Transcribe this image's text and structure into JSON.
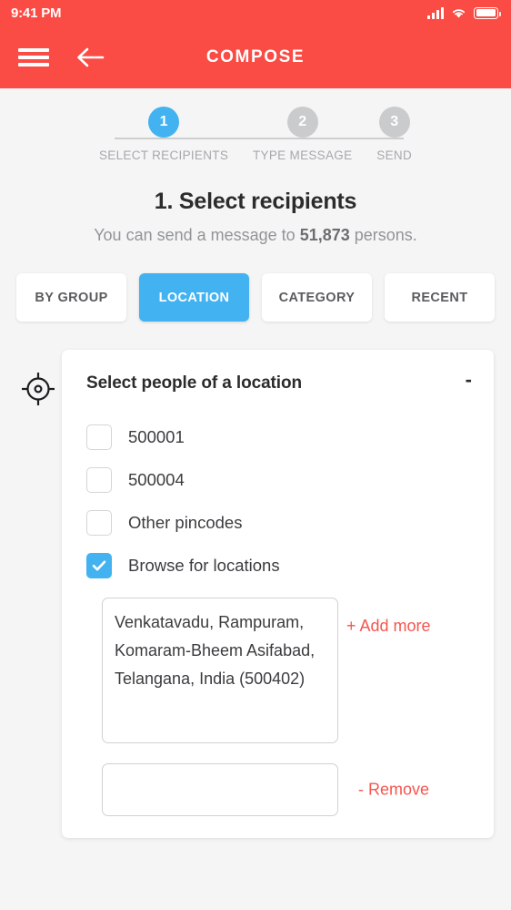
{
  "statusbar": {
    "time": "9:41 PM",
    "signal_icon": "signal-bars-icon",
    "wifi_icon": "wifi-icon",
    "battery_icon": "battery-icon"
  },
  "appbar": {
    "title": "COMPOSE",
    "menu_icon": "hamburger-menu-icon",
    "back_icon": "back-arrow-icon",
    "background_color": "#fa4b44"
  },
  "stepper": {
    "steps": [
      {
        "number": "1",
        "label": "SELECT RECIPIENTS",
        "active": true
      },
      {
        "number": "2",
        "label": "TYPE MESSAGE",
        "active": false
      },
      {
        "number": "3",
        "label": "SEND",
        "active": false
      }
    ],
    "active_color": "#42b2f0",
    "inactive_color": "#c9cbcd"
  },
  "heading": {
    "title": "1. Select recipients",
    "subtitle_prefix": "You can send a message to ",
    "subtitle_count": "51,873",
    "subtitle_suffix": " persons."
  },
  "tabs": [
    {
      "label": "BY GROUP",
      "active": false
    },
    {
      "label": "LOCATION",
      "active": true
    },
    {
      "label": "CATEGORY",
      "active": false
    },
    {
      "label": "RECENT",
      "active": false
    }
  ],
  "card": {
    "locate_icon": "crosshair-target-icon",
    "title": "Select people of a location",
    "collapse_label": "-",
    "options": [
      {
        "label": "500001",
        "checked": false
      },
      {
        "label": "500004",
        "checked": false
      },
      {
        "label": "Other pincodes",
        "checked": false
      },
      {
        "label": "Browse for locations",
        "checked": true
      }
    ],
    "entries": [
      {
        "value": "Venkatavadu, Rampuram, Komaram-Bheem Asifabad, Telangana, India (500402)",
        "placeholder": "",
        "action_label": "+ Add more"
      },
      {
        "value": "",
        "placeholder": "",
        "action_label": "- Remove"
      }
    ],
    "action_color": "#f4564f"
  }
}
